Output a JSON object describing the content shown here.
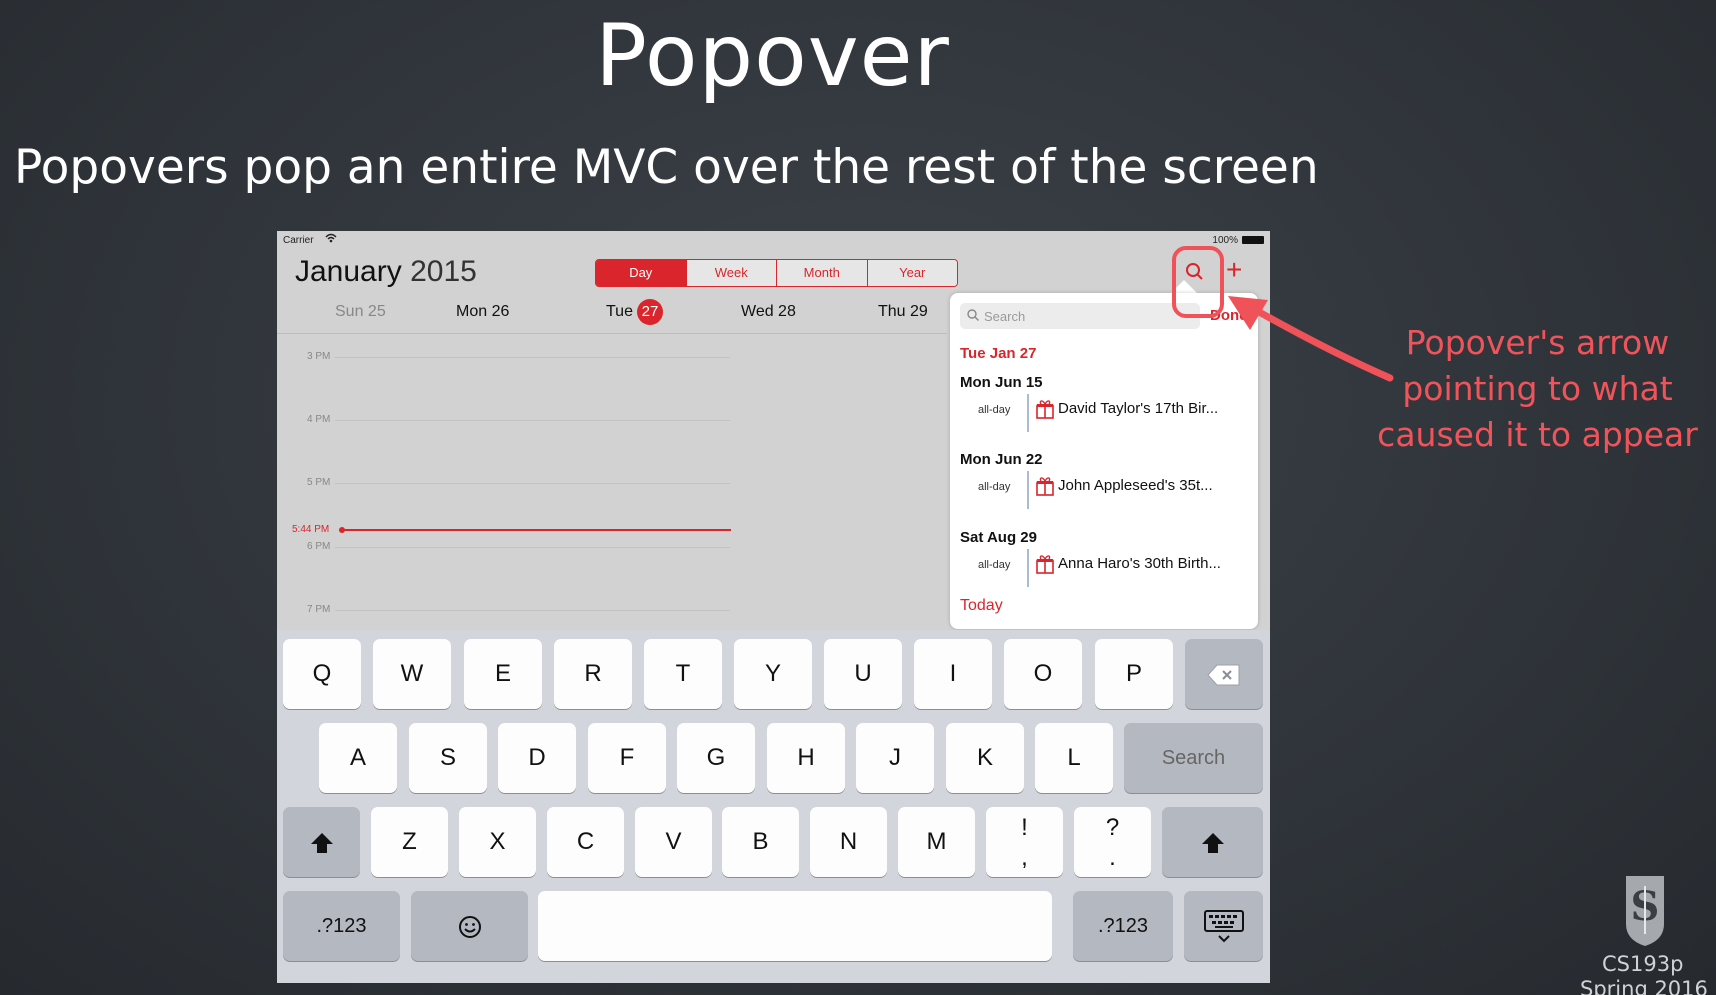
{
  "slide": {
    "title": "Popover",
    "subtitle": "Popovers pop an entire MVC over the rest of the screen",
    "annotation_lines": [
      "Popover's arrow",
      "pointing to what",
      "caused it to appear"
    ],
    "course": "CS193p",
    "term": "Spring 2016"
  },
  "status_bar": {
    "carrier": "Carrier",
    "battery": "100%"
  },
  "calendar": {
    "month": "January",
    "year": "2015",
    "segments": [
      "Day",
      "Week",
      "Month",
      "Year"
    ],
    "selected_segment": "Day",
    "days": [
      {
        "label": "Sun 25"
      },
      {
        "label": "Mon 26"
      },
      {
        "label": "Tue",
        "badge": "27"
      },
      {
        "label": "Wed 28"
      },
      {
        "label": "Thu 29"
      }
    ],
    "hours": [
      "3 PM",
      "4 PM",
      "5 PM",
      "6 PM",
      "7 PM"
    ],
    "now_label": "5:44 PM"
  },
  "popover": {
    "search_placeholder": "Search",
    "done_label": "Done",
    "current_day": "Tue  Jan 27",
    "groups": [
      {
        "heading": "Mon  Jun 15",
        "allday": "all-day",
        "event": "David Taylor's 17th Bir..."
      },
      {
        "heading": "Mon  Jun 22",
        "allday": "all-day",
        "event": "John Appleseed's 35t..."
      },
      {
        "heading": "Sat  Aug 29",
        "allday": "all-day",
        "event": "Anna Haro's 30th Birth..."
      }
    ],
    "today_label": "Today"
  },
  "keyboard": {
    "row1": [
      "Q",
      "W",
      "E",
      "R",
      "T",
      "Y",
      "U",
      "I",
      "O",
      "P"
    ],
    "row2": [
      "A",
      "S",
      "D",
      "F",
      "G",
      "H",
      "J",
      "K",
      "L"
    ],
    "row3": [
      "Z",
      "X",
      "C",
      "V",
      "B",
      "N",
      "M"
    ],
    "punct": [
      "!\n,",
      "?\n."
    ],
    "search_label": "Search",
    "numbers_label": ".?123"
  },
  "colors": {
    "accent": "#d9252b",
    "annotation": "#f0545a",
    "background": "#33383e"
  }
}
